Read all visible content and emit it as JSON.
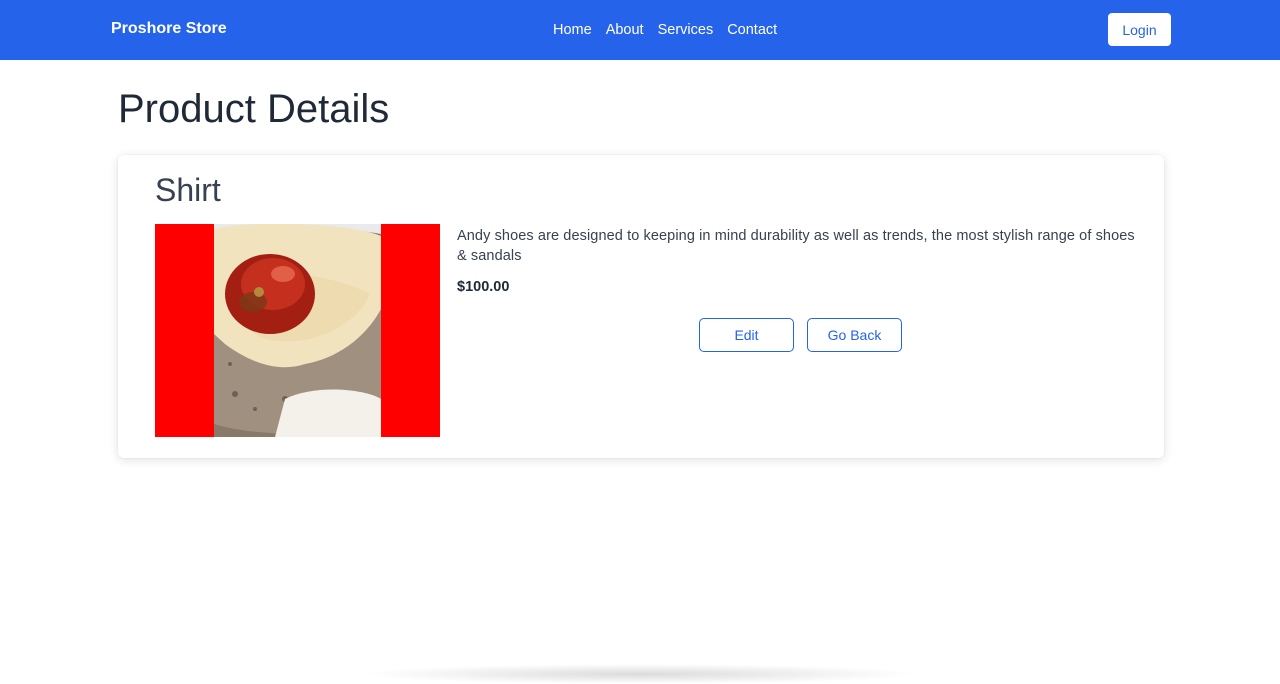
{
  "navbar": {
    "brand": "Proshore Store",
    "links": [
      "Home",
      "About",
      "Services",
      "Contact"
    ],
    "login_label": "Login",
    "color": "#2563eb"
  },
  "page": {
    "title": "Product Details"
  },
  "product": {
    "name": "Shirt",
    "description": "Andy shoes are designed to keeping in mind durability as well as trends, the most stylish range of shoes & sandals",
    "price": "$100.00",
    "image_icon": "product-photo-bread-with-tomato"
  },
  "actions": {
    "edit_label": "Edit",
    "back_label": "Go Back"
  }
}
